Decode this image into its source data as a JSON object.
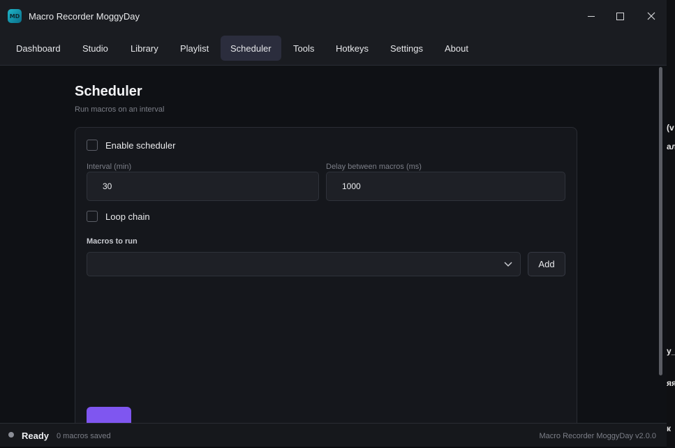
{
  "window": {
    "title": "Macro Recorder MoggyDay",
    "icon_text": "MD"
  },
  "nav": {
    "tabs": [
      {
        "label": "Dashboard"
      },
      {
        "label": "Studio"
      },
      {
        "label": "Library"
      },
      {
        "label": "Playlist"
      },
      {
        "label": "Scheduler",
        "active": true
      },
      {
        "label": "Tools"
      },
      {
        "label": "Hotkeys"
      },
      {
        "label": "Settings"
      },
      {
        "label": "About"
      }
    ]
  },
  "page": {
    "title": "Scheduler",
    "subtitle": "Run macros on an interval"
  },
  "form": {
    "enable_label": "Enable scheduler",
    "enable_checked": false,
    "interval_label": "Interval (min)",
    "interval_value": "30",
    "delay_label": "Delay between macros (ms)",
    "delay_value": "1000",
    "loop_label": "Loop chain",
    "loop_checked": false,
    "macros_label": "Macros to run",
    "macros_selected": "",
    "add_label": "Add"
  },
  "status": {
    "state": "Ready",
    "count": "0 macros saved",
    "version": "Macro Recorder MoggyDay v2.0.0"
  },
  "background_fragments": [
    "(v",
    "ал",
    "y_s",
    "яя",
    "к"
  ],
  "colors": {
    "accent": "#7f56f0",
    "active_tab": "#2b2d3d",
    "background": "#0f1115"
  }
}
